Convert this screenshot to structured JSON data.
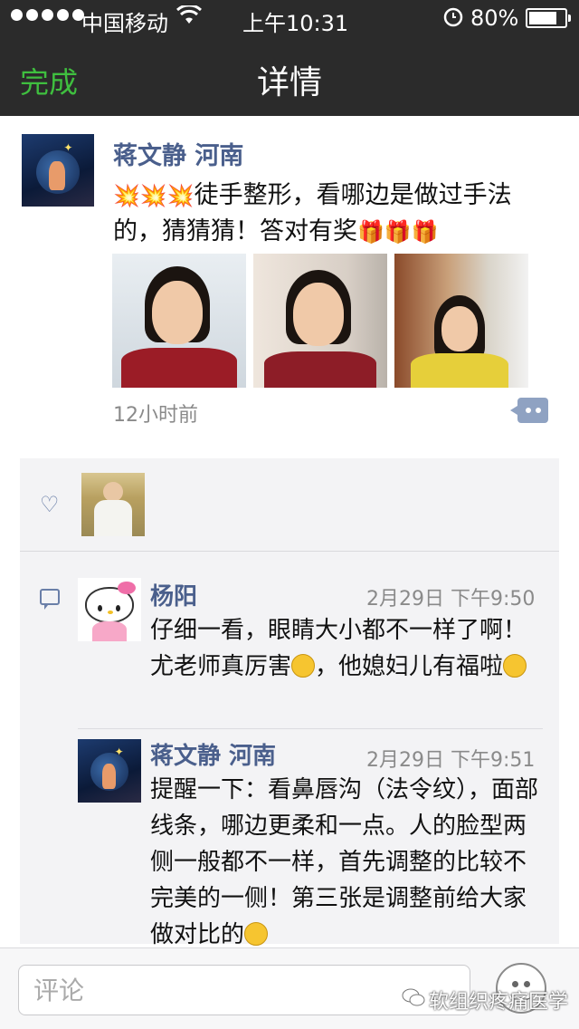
{
  "status_bar": {
    "carrier": "中国移动",
    "time": "上午10:31",
    "battery": "80%",
    "battery_level": 0.8
  },
  "nav": {
    "done_label": "完成",
    "title": "详情"
  },
  "post": {
    "author": "蒋文静 河南",
    "text_before": "徒手整形，看哪边是做过手法的，猜猜猜！答对有奖",
    "time": "12小时前",
    "photo_count": 3,
    "icons": [
      "collision-emoji",
      "collision-emoji",
      "collision-emoji",
      "gift-emoji",
      "gift-emoji",
      "gift-emoji",
      "comment-bubble-icon"
    ]
  },
  "likes": {
    "icon": "heart-icon",
    "users": [
      "liker-avatar"
    ]
  },
  "comments": [
    {
      "author": "杨阳",
      "time": "2月29日 下午9:50",
      "text_a": "仔细一看，眼睛大小都不一样了啊！尤老师真厉害",
      "text_b": "，他媳妇儿有福啦",
      "avatar_icon": "hello-kitty-avatar"
    },
    {
      "author": "蒋文静 河南",
      "time": "2月29日 下午9:51",
      "text": "提醒一下：看鼻唇沟（法令纹），面部线条，哪边更柔和一点。人的脸型两侧一般都不一样，首先调整的比较不完美的一侧！第三张是调整前给大家做对比的"
    }
  ],
  "input": {
    "placeholder": "评论"
  },
  "watermark": "软组织疼痛医学",
  "colors": {
    "nav_bg": "#2b2b2b",
    "done_green": "#3fbf3f",
    "name_blue": "#4a5f8c",
    "panel_bg": "#f3f3f5"
  }
}
